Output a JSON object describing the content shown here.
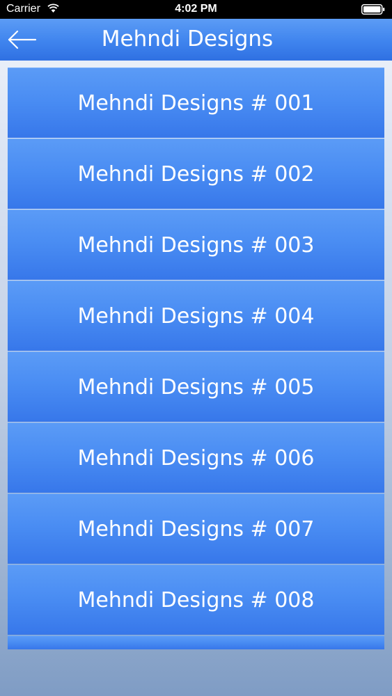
{
  "status_bar": {
    "carrier": "Carrier",
    "time": "4:02 PM",
    "wifi_icon": "wifi-icon",
    "battery_icon": "battery-icon"
  },
  "nav": {
    "title": "Mehndi Designs",
    "back_icon": "arrow-left-icon"
  },
  "items": [
    {
      "label": "Mehndi Designs # 001"
    },
    {
      "label": "Mehndi Designs # 002"
    },
    {
      "label": "Mehndi Designs # 003"
    },
    {
      "label": "Mehndi Designs # 004"
    },
    {
      "label": "Mehndi Designs # 005"
    },
    {
      "label": "Mehndi Designs # 006"
    },
    {
      "label": "Mehndi Designs # 007"
    },
    {
      "label": "Mehndi Designs # 008"
    }
  ],
  "colors": {
    "nav_blue": "#3f84ee",
    "item_blue": "#4a8df3",
    "text": "#ffffff"
  }
}
